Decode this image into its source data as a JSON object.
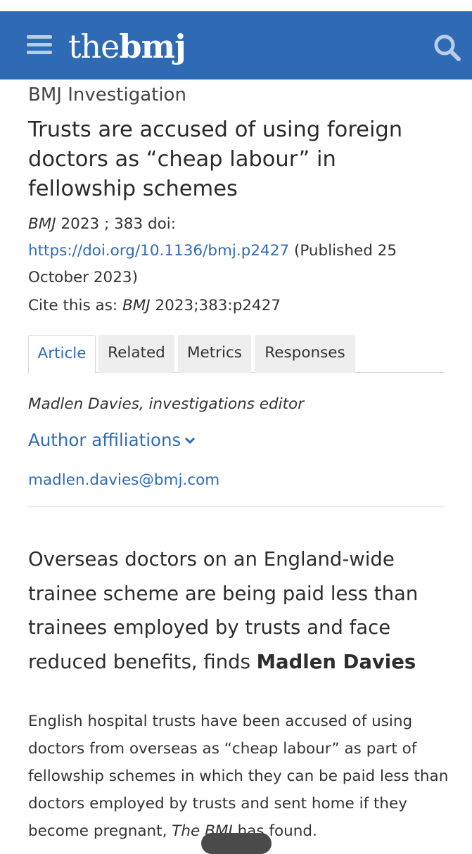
{
  "header": {
    "logo_the": "the",
    "logo_bmj": "bmj",
    "brand_color": "#2f6bb5",
    "menu_icon": "hamburger-menu-icon",
    "search_icon": "search-icon"
  },
  "article": {
    "section": "BMJ Investigation",
    "title": "Trusts are accused of using foreign doctors as “cheap labour” in fellowship schemes",
    "meta": {
      "journal": "BMJ",
      "year_volume": " 2023 ; 383  doi: ",
      "doi_link": "https://doi.org/10.1136/bmj.p2427",
      "published": " (Published 25 October 2023)"
    },
    "cite": {
      "prefix": "Cite this as: ",
      "journal": "BMJ",
      "ref": " 2023;383:p2427"
    },
    "tabs": [
      "Article",
      "Related",
      "Metrics",
      "Responses"
    ],
    "author": "Madlen Davies, investigations editor",
    "affiliations_label": "Author affiliations",
    "email": "madlen.davies@bmj.com",
    "standfirst": {
      "text": "Overseas doctors on an England-wide trainee scheme are being paid less than trainees employed by trusts and face reduced benefits, finds ",
      "author": "Madlen Davies"
    },
    "body": {
      "text": "English hospital trusts have been accused of using doctors from overseas as “cheap labour” as part of fellowship schemes in which they can be paid less than doctors employed by trusts and sent home if they become pregnant, ",
      "journal": "The BMJ",
      "end": " has found."
    }
  }
}
